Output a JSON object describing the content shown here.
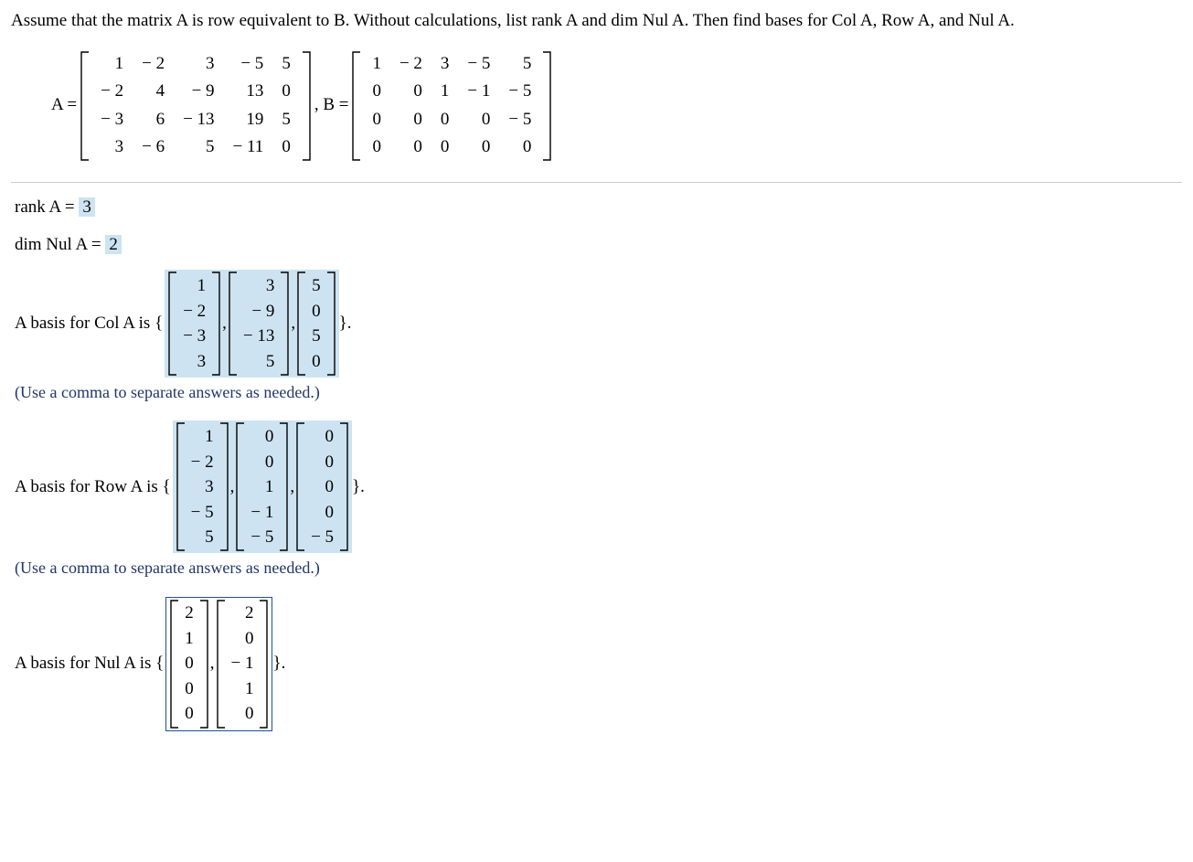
{
  "question": "Assume that the matrix A is row equivalent to B. Without calculations, list rank A and dim Nul A. Then find bases for Col A, Row A, and Nul A.",
  "labels": {
    "A_eq": "A =",
    "comma_B_eq": ", B =",
    "rank_label": "rank A = ",
    "dimnul_label": "dim Nul A = ",
    "col_label": "A basis for Col A is {",
    "row_label": "A basis for Row A is {",
    "nul_label": "A basis for Nul A is {",
    "close_brace": "}.",
    "hint": "(Use a comma to separate answers as needed.)",
    "vec_sep": ","
  },
  "matrix_A": [
    [
      "1",
      "− 2",
      "3",
      "− 5",
      "5"
    ],
    [
      "− 2",
      "4",
      "− 9",
      "13",
      "0"
    ],
    [
      "− 3",
      "6",
      "− 13",
      "19",
      "5"
    ],
    [
      "3",
      "− 6",
      "5",
      "− 11",
      "0"
    ]
  ],
  "matrix_B": [
    [
      "1",
      "− 2",
      "3",
      "− 5",
      "5"
    ],
    [
      "0",
      "0",
      "1",
      "− 1",
      "− 5"
    ],
    [
      "0",
      "0",
      "0",
      "0",
      "− 5"
    ],
    [
      "0",
      "0",
      "0",
      "0",
      "0"
    ]
  ],
  "rank_A": "3",
  "dim_nul_A": "2",
  "col_basis": [
    [
      "1",
      "− 2",
      "− 3",
      "3"
    ],
    [
      "3",
      "− 9",
      "− 13",
      "5"
    ],
    [
      "5",
      "0",
      "5",
      "0"
    ]
  ],
  "row_basis": [
    [
      "1",
      "− 2",
      "3",
      "− 5",
      "5"
    ],
    [
      "0",
      "0",
      "1",
      "− 1",
      "− 5"
    ],
    [
      "0",
      "0",
      "0",
      "0",
      "− 5"
    ]
  ],
  "nul_basis": [
    [
      "2",
      "1",
      "0",
      "0",
      "0"
    ],
    [
      "2",
      "0",
      "− 1",
      "1",
      "0"
    ]
  ]
}
